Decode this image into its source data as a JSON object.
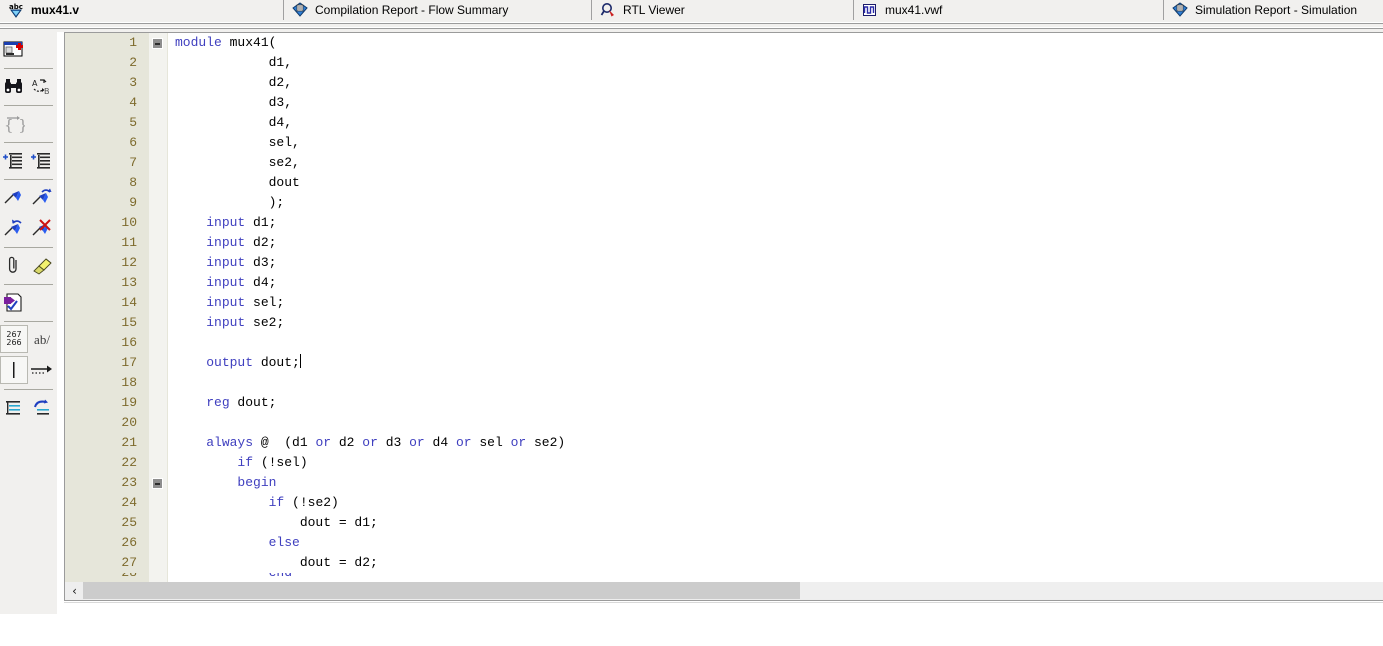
{
  "tabs": [
    {
      "label": "mux41.v",
      "icon": "abc-spell-check-icon",
      "active": true
    },
    {
      "label": "Compilation Report - Flow Summary",
      "icon": "report-diamond-icon",
      "active": false
    },
    {
      "label": "RTL Viewer",
      "icon": "rtl-magnifier-icon",
      "active": false
    },
    {
      "label": "mux41.vwf",
      "icon": "waveform-icon",
      "active": false
    },
    {
      "label": "Simulation Report - Simulation",
      "icon": "report-diamond-icon",
      "active": false
    }
  ],
  "toolbar": {
    "buttons": [
      {
        "name": "insert-template-button",
        "icon": "insert-template-icon"
      },
      {
        "name": "find-button",
        "icon": "binoculars-find-icon"
      },
      {
        "name": "find-replace-button",
        "icon": "find-replace-ab-icon"
      },
      {
        "name": "insert-braces-button",
        "icon": "curly-braces-icon"
      },
      {
        "name": "increase-indent-button",
        "icon": "indent-increase-icon"
      },
      {
        "name": "decrease-indent-button",
        "icon": "indent-decrease-icon"
      },
      {
        "name": "comment-button",
        "icon": "comment-pen-icon"
      },
      {
        "name": "uncomment-button",
        "icon": "uncomment-pen-icon"
      },
      {
        "name": "comment-selection-button",
        "icon": "comment-selection-pen-icon"
      },
      {
        "name": "remove-comment-button",
        "icon": "remove-comment-pen-icon"
      },
      {
        "name": "attach-button",
        "icon": "paperclip-icon"
      },
      {
        "name": "highlight-button",
        "icon": "highlighter-icon"
      },
      {
        "name": "analyze-file-button",
        "icon": "analyze-document-check-icon"
      },
      {
        "name": "line-numbers-button",
        "icon": "line-numbers-267-268-icon",
        "label_top": "267",
        "label_bottom": "266"
      },
      {
        "name": "spelling-button",
        "icon": "ab-slash-icon",
        "label": "ab/"
      },
      {
        "name": "insert-bar-button",
        "icon": "vertical-bar-icon"
      },
      {
        "name": "insert-arrow-button",
        "icon": "dotted-arrow-icon"
      },
      {
        "name": "align-button",
        "icon": "align-lines-icon"
      },
      {
        "name": "undo-align-button",
        "icon": "undo-align-icon"
      }
    ]
  },
  "editor": {
    "filename": "mux41.v",
    "language": "verilog",
    "caret_line": 17,
    "lines": [
      {
        "n": "1",
        "fold": true,
        "indent": 0,
        "tokens": [
          {
            "t": "module",
            "k": true
          },
          {
            "t": " mux41(",
            "k": false
          }
        ]
      },
      {
        "n": "2",
        "fold": false,
        "indent": 0,
        "tokens": [
          {
            "t": "            d1,",
            "k": false
          }
        ]
      },
      {
        "n": "3",
        "fold": false,
        "indent": 0,
        "tokens": [
          {
            "t": "            d2,",
            "k": false
          }
        ]
      },
      {
        "n": "4",
        "fold": false,
        "indent": 0,
        "tokens": [
          {
            "t": "            d3,",
            "k": false
          }
        ]
      },
      {
        "n": "5",
        "fold": false,
        "indent": 0,
        "tokens": [
          {
            "t": "            d4,",
            "k": false
          }
        ]
      },
      {
        "n": "6",
        "fold": false,
        "indent": 0,
        "tokens": [
          {
            "t": "            sel,",
            "k": false
          }
        ]
      },
      {
        "n": "7",
        "fold": false,
        "indent": 0,
        "tokens": [
          {
            "t": "            se2,",
            "k": false
          }
        ]
      },
      {
        "n": "8",
        "fold": false,
        "indent": 0,
        "tokens": [
          {
            "t": "            dout",
            "k": false
          }
        ]
      },
      {
        "n": "9",
        "fold": false,
        "indent": 0,
        "tokens": [
          {
            "t": "            );",
            "k": false
          }
        ]
      },
      {
        "n": "10",
        "fold": false,
        "indent": 0,
        "tokens": [
          {
            "t": "    ",
            "k": false
          },
          {
            "t": "input",
            "k": true
          },
          {
            "t": " d1;",
            "k": false
          }
        ]
      },
      {
        "n": "11",
        "fold": false,
        "indent": 0,
        "tokens": [
          {
            "t": "    ",
            "k": false
          },
          {
            "t": "input",
            "k": true
          },
          {
            "t": " d2;",
            "k": false
          }
        ]
      },
      {
        "n": "12",
        "fold": false,
        "indent": 0,
        "tokens": [
          {
            "t": "    ",
            "k": false
          },
          {
            "t": "input",
            "k": true
          },
          {
            "t": " d3;",
            "k": false
          }
        ]
      },
      {
        "n": "13",
        "fold": false,
        "indent": 0,
        "tokens": [
          {
            "t": "    ",
            "k": false
          },
          {
            "t": "input",
            "k": true
          },
          {
            "t": " d4;",
            "k": false
          }
        ]
      },
      {
        "n": "14",
        "fold": false,
        "indent": 0,
        "tokens": [
          {
            "t": "    ",
            "k": false
          },
          {
            "t": "input",
            "k": true
          },
          {
            "t": " sel;",
            "k": false
          }
        ]
      },
      {
        "n": "15",
        "fold": false,
        "indent": 0,
        "tokens": [
          {
            "t": "    ",
            "k": false
          },
          {
            "t": "input",
            "k": true
          },
          {
            "t": " se2;",
            "k": false
          }
        ]
      },
      {
        "n": "16",
        "fold": false,
        "indent": 0,
        "tokens": []
      },
      {
        "n": "17",
        "fold": false,
        "indent": 0,
        "caret": true,
        "tokens": [
          {
            "t": "    ",
            "k": false
          },
          {
            "t": "output",
            "k": true
          },
          {
            "t": " dout;",
            "k": false
          }
        ]
      },
      {
        "n": "18",
        "fold": false,
        "indent": 0,
        "tokens": []
      },
      {
        "n": "19",
        "fold": false,
        "indent": 0,
        "tokens": [
          {
            "t": "    ",
            "k": false
          },
          {
            "t": "reg",
            "k": true
          },
          {
            "t": " dout;",
            "k": false
          }
        ]
      },
      {
        "n": "20",
        "fold": false,
        "indent": 0,
        "tokens": []
      },
      {
        "n": "21",
        "fold": false,
        "indent": 0,
        "tokens": [
          {
            "t": "    ",
            "k": false
          },
          {
            "t": "always",
            "k": true
          },
          {
            "t": " @  (d1 ",
            "k": false
          },
          {
            "t": "or",
            "k": true
          },
          {
            "t": " d2 ",
            "k": false
          },
          {
            "t": "or",
            "k": true
          },
          {
            "t": " d3 ",
            "k": false
          },
          {
            "t": "or",
            "k": true
          },
          {
            "t": " d4 ",
            "k": false
          },
          {
            "t": "or",
            "k": true
          },
          {
            "t": " sel ",
            "k": false
          },
          {
            "t": "or",
            "k": true
          },
          {
            "t": " se2)",
            "k": false
          }
        ]
      },
      {
        "n": "22",
        "fold": false,
        "indent": 0,
        "tokens": [
          {
            "t": "        ",
            "k": false
          },
          {
            "t": "if",
            "k": true
          },
          {
            "t": " (!sel)",
            "k": false
          }
        ]
      },
      {
        "n": "23",
        "fold": true,
        "indent": 0,
        "tokens": [
          {
            "t": "        ",
            "k": false
          },
          {
            "t": "begin",
            "k": true
          }
        ]
      },
      {
        "n": "24",
        "fold": false,
        "indent": 0,
        "tokens": [
          {
            "t": "            ",
            "k": false
          },
          {
            "t": "if",
            "k": true
          },
          {
            "t": " (!se2)",
            "k": false
          }
        ]
      },
      {
        "n": "25",
        "fold": false,
        "indent": 0,
        "tokens": [
          {
            "t": "                dout = d1;",
            "k": false
          }
        ]
      },
      {
        "n": "26",
        "fold": false,
        "indent": 0,
        "tokens": [
          {
            "t": "            ",
            "k": false
          },
          {
            "t": "else",
            "k": true
          }
        ]
      },
      {
        "n": "27",
        "fold": false,
        "indent": 0,
        "tokens": [
          {
            "t": "                dout = d2;",
            "k": false
          }
        ]
      },
      {
        "n": "28",
        "fold": false,
        "indent": 0,
        "clipped": true,
        "tokens": [
          {
            "t": "            ",
            "k": false
          },
          {
            "t": "end",
            "k": true
          }
        ]
      }
    ]
  },
  "scrollbar": {
    "left_arrow": "‹",
    "thumb_position_percent": 0,
    "thumb_width_percent": 55
  },
  "colors": {
    "keyword": "#3f3fbf",
    "text": "#000000",
    "line_number": "#7d6a2c",
    "gutter_bg": "#e6e6da",
    "editor_bg": "#ffffff",
    "chrome_bg": "#f1f0ee",
    "scrollbar_thumb": "#cccccc"
  }
}
